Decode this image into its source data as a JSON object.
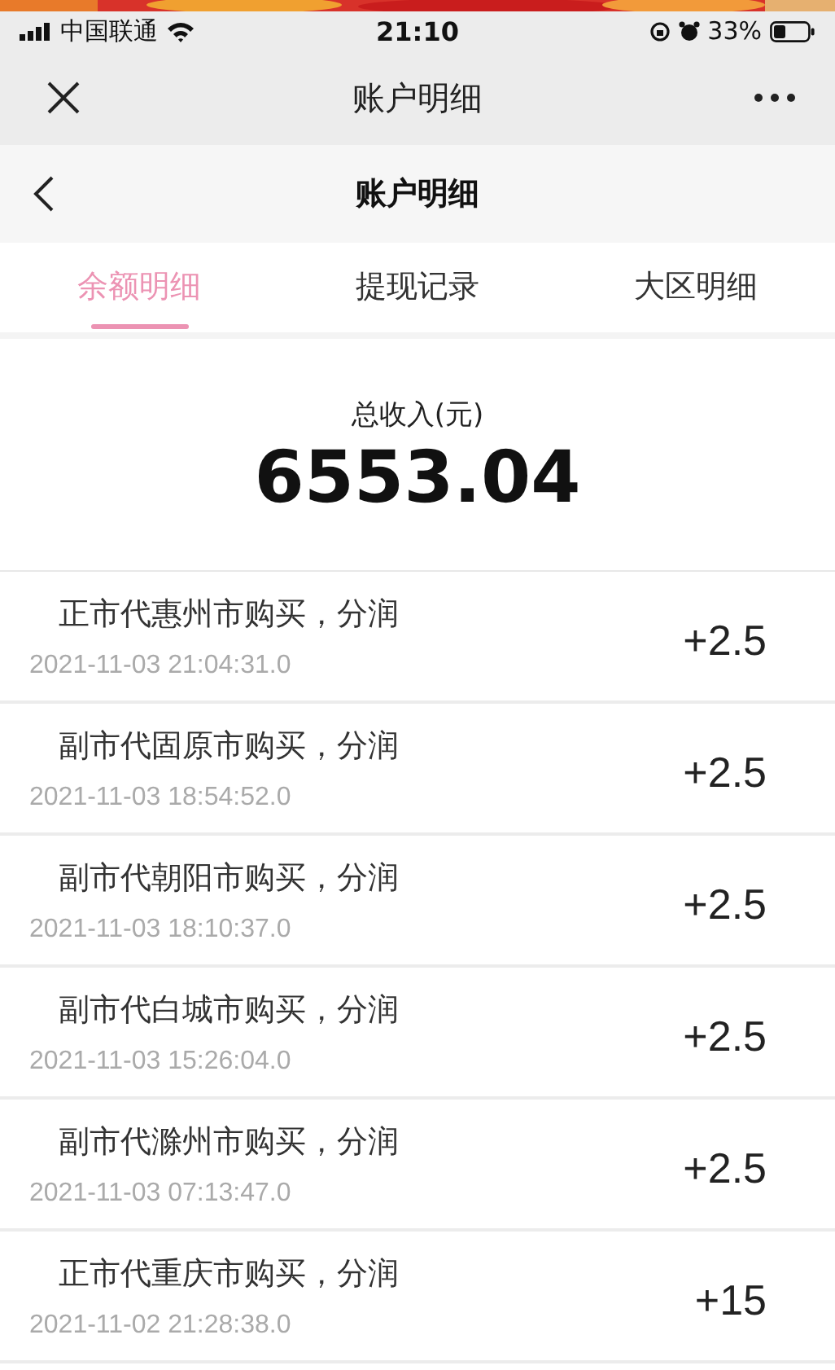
{
  "status_bar": {
    "carrier": "中国联通",
    "time": "21:10",
    "battery": "33%"
  },
  "nav_bar": {
    "title": "账户明细"
  },
  "header": {
    "title": "账户明细"
  },
  "tabs": [
    {
      "label": "余额明细",
      "selected": true
    },
    {
      "label": "提现记录",
      "selected": false
    },
    {
      "label": "大区明细",
      "selected": false
    }
  ],
  "total": {
    "label": "总收入(元)",
    "amount": "6553.04"
  },
  "records": [
    {
      "title": "正市代惠州市购买，分润",
      "time": "2021-11-03 21:04:31.0",
      "amount": "+2.5"
    },
    {
      "title": "副市代固原市购买，分润",
      "time": "2021-11-03 18:54:52.0",
      "amount": "+2.5"
    },
    {
      "title": "副市代朝阳市购买，分润",
      "time": "2021-11-03 18:10:37.0",
      "amount": "+2.5"
    },
    {
      "title": "副市代白城市购买，分润",
      "time": "2021-11-03 15:26:04.0",
      "amount": "+2.5"
    },
    {
      "title": "副市代滁州市购买，分润",
      "time": "2021-11-03 07:13:47.0",
      "amount": "+2.5"
    },
    {
      "title": "正市代重庆市购买，分润",
      "time": "2021-11-02 21:28:38.0",
      "amount": "+15"
    }
  ]
}
